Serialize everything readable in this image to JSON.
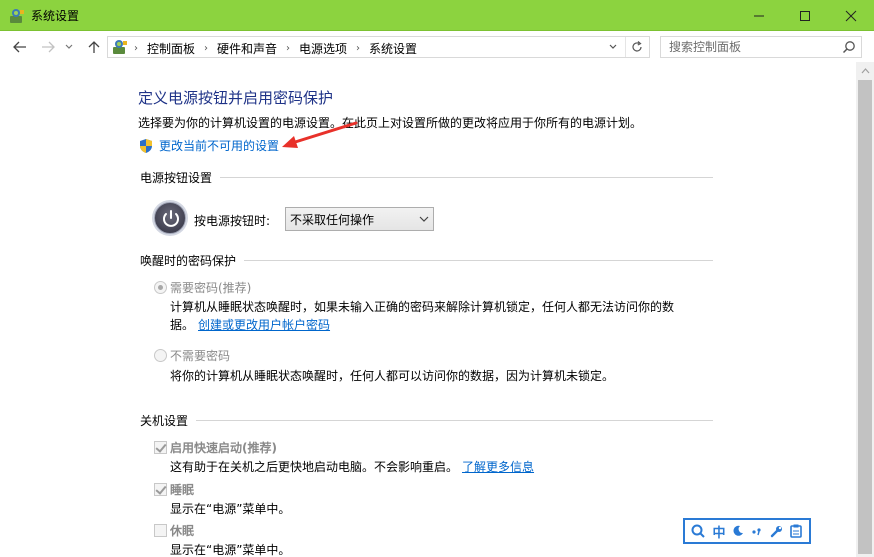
{
  "window": {
    "title": "系统设置",
    "icon": "control-panel-icon",
    "titlebar_color": "#8cd33f"
  },
  "nav": {
    "breadcrumbs": [
      "控制面板",
      "硬件和声音",
      "电源选项",
      "系统设置"
    ],
    "search_placeholder": "搜索控制面板"
  },
  "page": {
    "title": "定义电源按钮并启用密码保护",
    "description": "选择要为你的计算机设置的电源设置。在此页上对设置所做的更改将应用于你所有的电源计划。",
    "change_settings_link": "更改当前不可用的设置"
  },
  "power_section": {
    "header": "电源按钮设置",
    "label": "按电源按钮时:",
    "selected": "不采取任何操作"
  },
  "password_section": {
    "header": "唤醒时的密码保护",
    "require": {
      "label": "需要密码(推荐)",
      "desc_line1": "计算机从睡眠状态唤醒时，如果未输入正确的密码来解除计算机锁定，任何人都无法访问你的数",
      "desc_line2_prefix": "据。",
      "link": "创建或更改用户帐户密码"
    },
    "no_require": {
      "label": "不需要密码",
      "desc": "将你的计算机从睡眠状态唤醒时，任何人都可以访问你的数据，因为计算机未锁定。"
    }
  },
  "shutdown_section": {
    "header": "关机设置",
    "fast_startup": {
      "label": "启用快速启动(推荐)",
      "desc": "这有助于在关机之后更快地启动电脑。不会影响重启。",
      "link": "了解更多信息",
      "checked": true
    },
    "sleep": {
      "label": "睡眠",
      "desc": "显示在“电源”菜单中。",
      "checked": true
    },
    "hibernate": {
      "label": "休眠",
      "desc": "显示在“电源”菜单中。",
      "checked": false
    }
  },
  "ime": {
    "lang": "中"
  },
  "colors": {
    "accent": "#0066cc",
    "title_blue": "#1e3287",
    "red_arrow": "#e8312a"
  }
}
